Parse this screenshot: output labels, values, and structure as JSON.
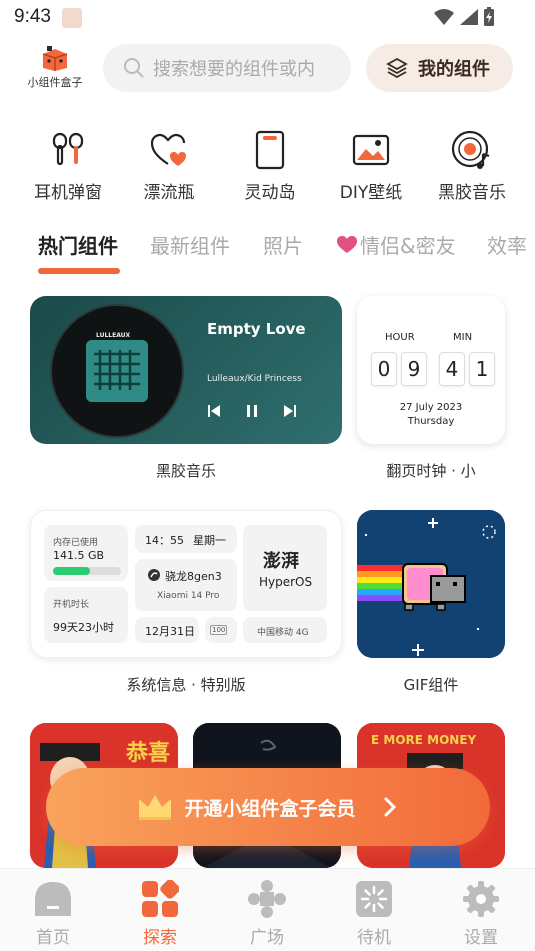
{
  "status_bar": {
    "time": "9:43"
  },
  "header": {
    "logo_label": "小组件盒子",
    "search_placeholder": "搜索想要的组件或内",
    "my_widgets_label": "我的组件"
  },
  "categories": [
    {
      "label": "耳机弹窗",
      "icon": "earbuds-icon"
    },
    {
      "label": "漂流瓶",
      "icon": "heart-cup-icon"
    },
    {
      "label": "灵动岛",
      "icon": "phone-island-icon"
    },
    {
      "label": "DIY壁纸",
      "icon": "wallpaper-icon"
    },
    {
      "label": "黑胶音乐",
      "icon": "vinyl-icon"
    }
  ],
  "tabs": [
    {
      "label": "热门组件",
      "active": true
    },
    {
      "label": "最新组件"
    },
    {
      "label": "照片"
    },
    {
      "label": "情侣&密友"
    },
    {
      "label": "效率"
    }
  ],
  "widgets": {
    "music": {
      "caption": "黑胶音乐",
      "album_text": "LULLEAUX",
      "song_title": "Empty Love",
      "artist": "Lulleaux/Kid Princess"
    },
    "clock": {
      "caption": "翻页时钟 · 小",
      "hour_label": "HOUR",
      "min_label": "MIN",
      "digits": [
        "0",
        "9",
        "4",
        "1"
      ],
      "date": "27 July 2023",
      "weekday": "Thursday"
    },
    "sysinfo": {
      "caption": "系统信息 · 特别版",
      "storage_label": "内存已使用",
      "storage_value": "141.5 GB",
      "storage_fraction": 0.55,
      "uptime_label": "开机时长",
      "uptime_value": "99天23小时",
      "time": "14：55",
      "weekday": "星期一",
      "chip": "骁龙8gen3",
      "device": "Xiaomi 14 Pro",
      "os_brand_cn": "澎湃",
      "os_brand": "HyperOS",
      "date": "12月31日",
      "battery": "100",
      "carrier": "中国移动 4G"
    },
    "gif": {
      "caption": "GIF组件"
    },
    "bottom_row": {
      "card3_text": "E MORE MONEY",
      "card1_text": "恭喜"
    }
  },
  "vip_banner": {
    "label": "开通小组件盒子会员"
  },
  "bottom_nav": [
    {
      "label": "首页",
      "icon": "home-icon"
    },
    {
      "label": "探索",
      "icon": "explore-icon",
      "active": true
    },
    {
      "label": "广场",
      "icon": "plaza-icon"
    },
    {
      "label": "待机",
      "icon": "standby-icon"
    },
    {
      "label": "设置",
      "icon": "settings-icon"
    }
  ],
  "colors": {
    "accent": "#f2673b",
    "vip_start": "#f9a35c",
    "vip_end": "#f26a3a",
    "music_bg": "#1b4a4a",
    "gif_bg": "#114272"
  }
}
